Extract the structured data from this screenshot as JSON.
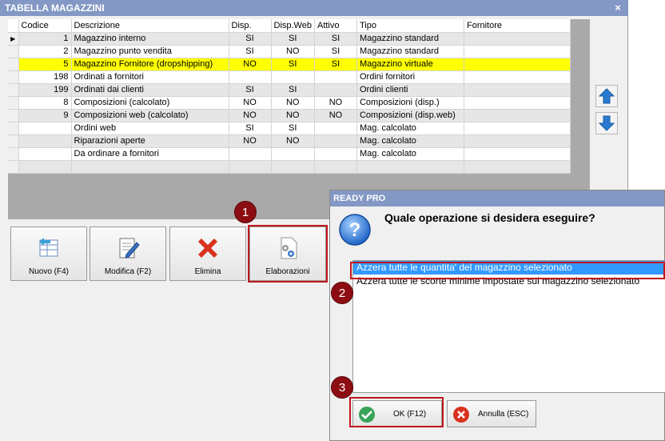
{
  "window": {
    "title": "TABELLA MAGAZZINI",
    "close_glyph": "×"
  },
  "grid": {
    "columns": [
      "Codice",
      "Descrizione",
      "Disp.",
      "Disp.Web",
      "Attivo",
      "Tipo",
      "Fornitore"
    ],
    "rows": [
      [
        "1",
        "Magazzino interno",
        "SI",
        "SI",
        "SI",
        "Magazzino standard",
        ""
      ],
      [
        "2",
        "Magazzino punto vendita",
        "SI",
        "NO",
        "SI",
        "Magazzino standard",
        ""
      ],
      [
        "5",
        "Magazzino Fornitore (dropshipping)",
        "NO",
        "SI",
        "SI",
        "Magazzino virtuale",
        ""
      ],
      [
        "198",
        "Ordinati a fornitori",
        "",
        "",
        "",
        "Ordini fornitori",
        ""
      ],
      [
        "199",
        "Ordinati dai clienti",
        "SI",
        "SI",
        "",
        "Ordini clienti",
        ""
      ],
      [
        "8",
        "Composizioni (calcolato)",
        "NO",
        "NO",
        "NO",
        "Composizioni (disp.)",
        ""
      ],
      [
        "9",
        "Composizioni web (calcolato)",
        "NO",
        "NO",
        "NO",
        "Composizioni (disp.web)",
        ""
      ],
      [
        "",
        "Ordini web",
        "SI",
        "SI",
        "",
        "Mag. calcolato",
        ""
      ],
      [
        "",
        "Riparazioni aperte",
        "NO",
        "NO",
        "",
        "Mag. calcolato",
        ""
      ],
      [
        "",
        "Da ordinare a fornitori",
        "",
        "",
        "",
        "Mag. calcolato",
        ""
      ],
      [
        "",
        "",
        "",
        "",
        "",
        "",
        ""
      ]
    ],
    "current_row_marker": "▶",
    "highlight_color": "#ffff00"
  },
  "toolbar": {
    "nuovo": "Nuovo (F4)",
    "modifica": "Modifica (F2)",
    "elimina": "Elimina",
    "elaborazioni": "Elaborazioni"
  },
  "callouts": [
    "1",
    "2",
    "3"
  ],
  "dialog": {
    "title": "READY PRO",
    "question": "Quale operazione si desidera eseguire?",
    "options": [
      "Azzera tutte le quantita' del magazzino selezionato",
      "Azzera tutte le scorte minime impostate sul magazzino selezionato"
    ],
    "ok": "OK (F12)",
    "annulla": "Annulla (ESC)"
  },
  "colors": {
    "titlebar": "#8398c4",
    "callout": "#8c0e12",
    "selection": "#3399ff",
    "accent_red": "#c0161c"
  }
}
